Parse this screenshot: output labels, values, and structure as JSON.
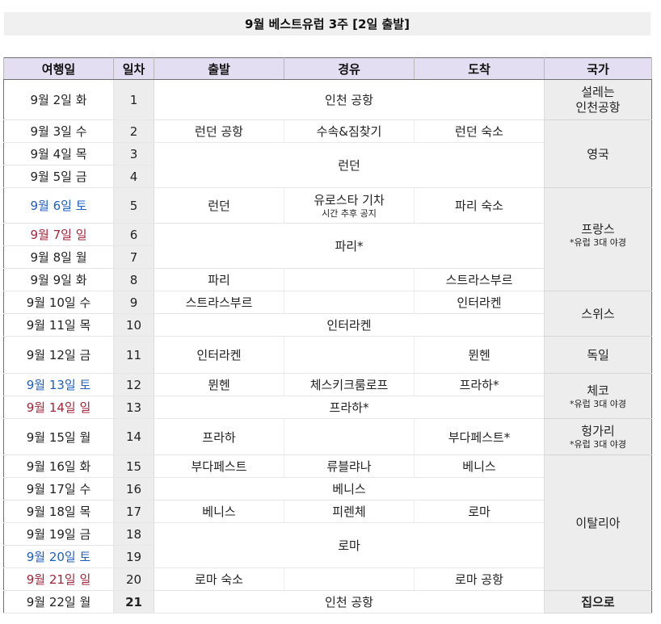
{
  "title": "9월 베스트유럽 3주 [2일 출발]",
  "headers": {
    "date": "여행일",
    "day": "일차",
    "depart": "출발",
    "via": "경유",
    "arrive": "도착",
    "country": "국가"
  },
  "rows": [
    {
      "date": "9월 2일 화",
      "day": "1",
      "via": "인천 공항"
    },
    {
      "date": "9월 3일 수",
      "day": "2",
      "depart": "런던 공항",
      "via": "수속&짐찾기",
      "arrive": "런던 숙소"
    },
    {
      "date": "9월 4일 목",
      "day": "3",
      "via": "런던"
    },
    {
      "date": "9월 5일 금",
      "day": "4"
    },
    {
      "date": "9월 6일 토",
      "day": "5",
      "depart": "런던",
      "via": "유로스타 기차",
      "via_note": "시간 추후 공지",
      "arrive": "파리 숙소"
    },
    {
      "date": "9월 7일 일",
      "day": "6",
      "via": "파리*"
    },
    {
      "date": "9월 8일 월",
      "day": "7"
    },
    {
      "date": "9월 9일 화",
      "day": "8",
      "depart": "파리",
      "arrive": "스트라스부르"
    },
    {
      "date": "9월 10일 수",
      "day": "9",
      "depart": "스트라스부르",
      "arrive": "인터라켄"
    },
    {
      "date": "9월 11일 목",
      "day": "10",
      "via": "인터라켄"
    },
    {
      "date": "9월 12일 금",
      "day": "11",
      "depart": "인터라켄",
      "arrive": "뮌헨"
    },
    {
      "date": "9월 13일 토",
      "day": "12",
      "depart": "뮌헨",
      "via": "체스키크룸로프",
      "arrive": "프라하*"
    },
    {
      "date": "9월 14일 일",
      "day": "13",
      "via": "프라하*"
    },
    {
      "date": "9월 15일 월",
      "day": "14",
      "depart": "프라하",
      "arrive": "부다페스트*"
    },
    {
      "date": "9월 16일 화",
      "day": "15",
      "depart": "부다페스트",
      "via": "류블랴나",
      "arrive": "베니스"
    },
    {
      "date": "9월 17일 수",
      "day": "16",
      "via": "베니스"
    },
    {
      "date": "9월 18일 목",
      "day": "17",
      "depart": "베니스",
      "via": "피렌체",
      "arrive": "로마"
    },
    {
      "date": "9월 19일 금",
      "day": "18",
      "via": "로마"
    },
    {
      "date": "9월 20일 토",
      "day": "19"
    },
    {
      "date": "9월 21일 일",
      "day": "20",
      "depart": "로마 숙소",
      "arrive": "로마 공항"
    },
    {
      "date": "9월 22일 월",
      "day": "21",
      "via": "인천 공항"
    }
  ],
  "countries": {
    "c1_line1": "설레는",
    "c1_line2": "인천공항",
    "c2": "영국",
    "c3": "프랑스",
    "c3_note": "*유럽 3대 야경",
    "c4": "스위스",
    "c5": "독일",
    "c6": "체코",
    "c6_note": "*유럽 3대 야경",
    "c7": "헝가리",
    "c7_note": "*유럽 3대 야경",
    "c8": "이탈리아",
    "c9": "집으로"
  },
  "colors": {
    "header_bg": "#e3def2",
    "shaded_bg": "#ededed",
    "saturday": "#1f5fbd",
    "sunday": "#a2263a"
  }
}
